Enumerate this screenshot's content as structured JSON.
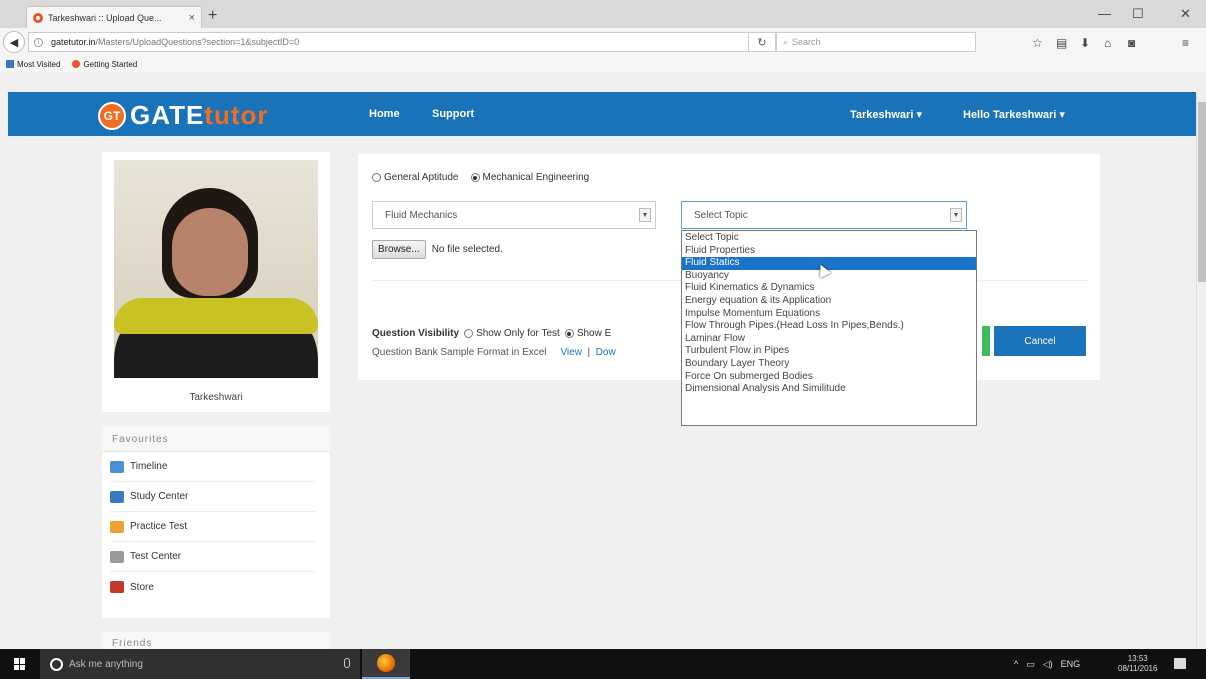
{
  "browser": {
    "tab_title": "Tarkeshwari :: Upload Que...",
    "tab_close": "×",
    "new_tab": "+",
    "url_host": "gatetutor.in",
    "url_path": "/Masters/UploadQuestions?section=1&subjectID=0",
    "search_placeholder": "Search",
    "bookmarks": [
      "Most Visited",
      "Getting Started"
    ],
    "window_controls": [
      "—",
      "☐",
      "✕"
    ]
  },
  "site": {
    "logo_badge": "GT",
    "logo_gate": "GATE",
    "logo_tutor": "tutor",
    "nav": [
      "Home",
      "Support"
    ],
    "user_menu": "Tarkeshwari ▾",
    "greeting_menu": "Hello Tarkeshwari ▾"
  },
  "profile": {
    "name": "Tarkeshwari"
  },
  "favourites": {
    "title": "Favourites",
    "items": [
      {
        "label": "Timeline",
        "icon": "timeline-icon",
        "color": "#4a90d9"
      },
      {
        "label": "Study Center",
        "icon": "study-center-icon",
        "color": "#3a78c2"
      },
      {
        "label": "Practice Test",
        "icon": "practice-test-icon",
        "color": "#f0a030"
      },
      {
        "label": "Test Center",
        "icon": "test-center-icon",
        "color": "#9a9a9a"
      },
      {
        "label": "Store",
        "icon": "store-icon",
        "color": "#c0392b"
      }
    ]
  },
  "friends": {
    "title": "Friends"
  },
  "upload": {
    "radio_general": "General Aptitude",
    "radio_mechanical": "Mechanical Engineering",
    "subject_value": "Fluid Mechanics",
    "topic_value": "Select Topic",
    "browse_label": "Browse...",
    "file_status": "No file selected.",
    "visibility_label": "Question Visibility",
    "visibility_opt1": "Show Only for Test",
    "visibility_opt2": "Show E",
    "sample_label": "Question Bank Sample Format in Excel",
    "view_link": "View",
    "sep": "|",
    "download_link": "Dow",
    "cancel_label": "Cancel"
  },
  "topic_options": [
    "Select Topic",
    "Fluid Properties",
    "Fluid Statics",
    "Buoyancy",
    "Fluid Kinematics & Dynamics",
    "Energy equation & its Application",
    "Impulse Momentum Equations",
    "Flow Through Pipes.(Head Loss In Pipes,Bends.)",
    "Laminar Flow",
    "Turbulent Flow in Pipes",
    "Boundary Layer Theory",
    "Force On submerged Bodies",
    "Dimensional Analysis And Similitude"
  ],
  "selected_topic_index": 2,
  "taskbar": {
    "search_text": "Ask me anything",
    "lang": "ENG",
    "time": "13:53",
    "date": "08/11/2016"
  },
  "colors": {
    "brand_blue": "#1a73b8",
    "brand_orange": "#f26d21",
    "selected_option": "#1a73c8"
  }
}
